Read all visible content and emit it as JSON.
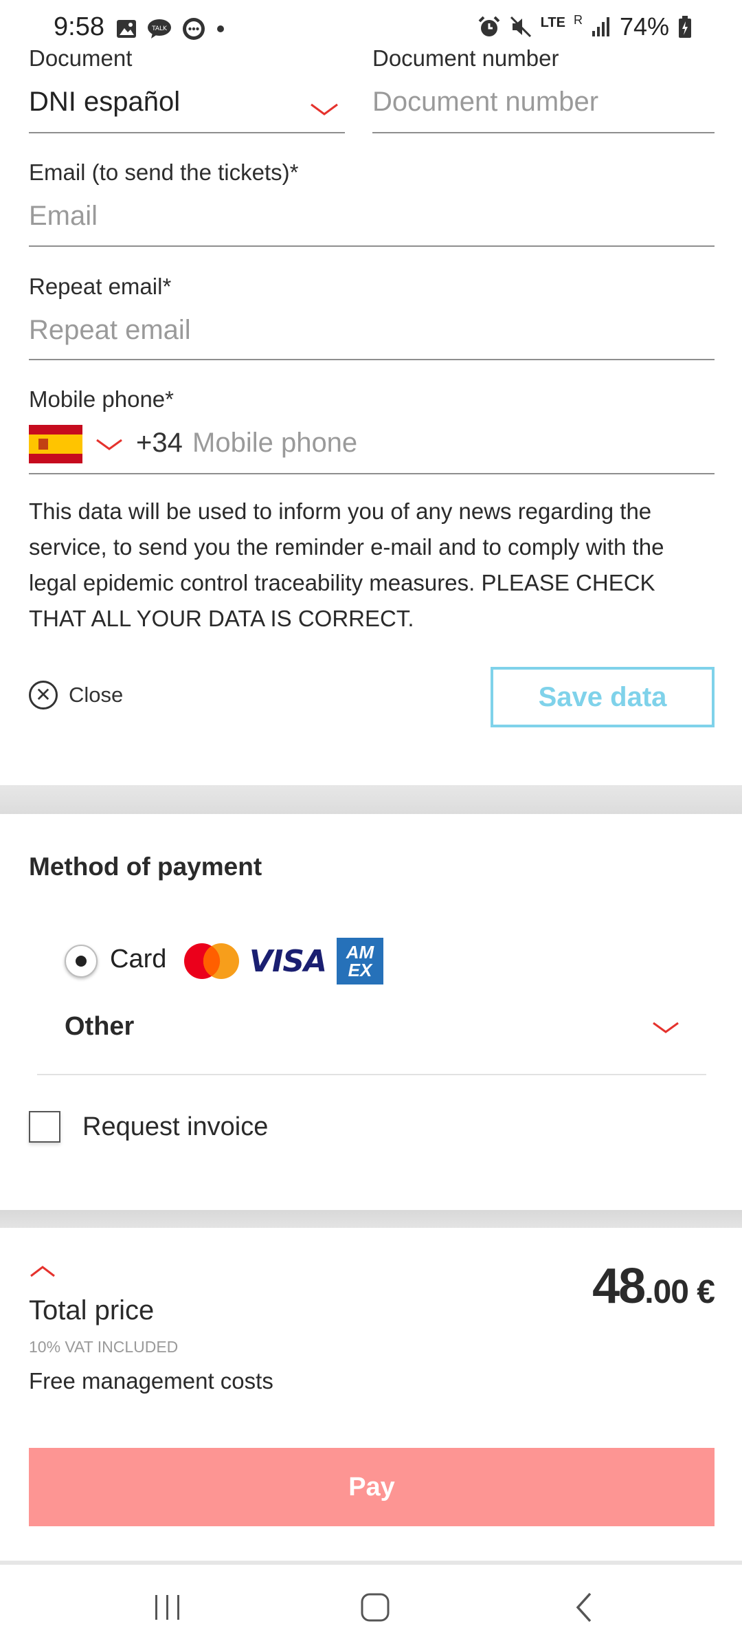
{
  "status_bar": {
    "time": "9:58",
    "notification_icons": [
      "image-icon",
      "talk-icon",
      "messages-icon",
      "dot-icon"
    ],
    "network": "LTE",
    "roaming": "R",
    "battery": "74%"
  },
  "form": {
    "document": {
      "label": "Document",
      "value": "DNI español"
    },
    "document_number": {
      "label": "Document number",
      "placeholder": "Document number"
    },
    "email": {
      "label": "Email (to send the tickets)*",
      "placeholder": "Email"
    },
    "repeat_email": {
      "label": "Repeat email*",
      "placeholder": "Repeat email"
    },
    "mobile_phone": {
      "label": "Mobile phone*",
      "country_code": "+34",
      "placeholder": "Mobile phone",
      "flag": "spain-flag"
    },
    "notice": "This data will be used to inform you of any news regarding the service, to send you the reminder e-mail and to comply with the legal epidemic control traceability measures. PLEASE CHECK THAT ALL YOUR DATA IS CORRECT.",
    "close_label": "Close",
    "save_label": "Save data"
  },
  "payment": {
    "title": "Method of payment",
    "card_label": "Card",
    "card_selected": true,
    "card_brands": [
      "mastercard",
      "visa",
      "amex"
    ],
    "visa_text": "VISA",
    "amex_text_top": "AM",
    "amex_text_bottom": "EX",
    "other_label": "Other",
    "invoice_label": "Request invoice",
    "invoice_checked": false
  },
  "summary": {
    "total_label": "Total price",
    "vat_note": "10% VAT INCLUDED",
    "management_note": "Free management costs",
    "price_integer": "48",
    "price_decimal": ".00 €",
    "pay_label": "Pay"
  },
  "colors": {
    "accent_red": "#e5322d",
    "save_outline": "#7fd2ea",
    "pay_button": "#fd9593"
  }
}
